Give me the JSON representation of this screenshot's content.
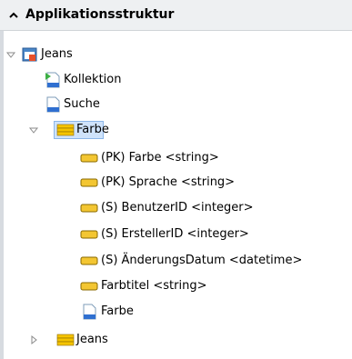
{
  "header": {
    "title": "Applikationsstruktur",
    "icon": "chevron-up-icon"
  },
  "tree": {
    "root": {
      "label": "Jeans",
      "icon": "application-icon",
      "expanded": true
    },
    "kollektion": {
      "label": "Kollektion",
      "icon": "page-arrow-icon"
    },
    "suche": {
      "label": "Suche",
      "icon": "page-icon"
    },
    "farbe_table": {
      "label": "Farbe",
      "icon": "table-icon",
      "expanded": true,
      "selected": true
    },
    "fields": [
      {
        "label": "(PK) Farbe <string>",
        "icon": "field-icon"
      },
      {
        "label": "(PK) Sprache <string>",
        "icon": "field-icon"
      },
      {
        "label": "(S) BenutzerID <integer>",
        "icon": "field-icon"
      },
      {
        "label": "(S) ErstellerID <integer>",
        "icon": "field-icon"
      },
      {
        "label": "(S) ÄnderungsDatum <datetime>",
        "icon": "field-icon"
      },
      {
        "label": "Farbtitel <string>",
        "icon": "field-icon"
      }
    ],
    "farbe_page": {
      "label": "Farbe",
      "icon": "page-icon"
    },
    "jeans_table": {
      "label": "Jeans",
      "icon": "table-icon",
      "expanded": false
    }
  },
  "colors": {
    "selection": "#cfe3fb",
    "selection_border": "#8cb6e8",
    "field_yellow": "#f3c632",
    "table_yellow": "#f5c400"
  }
}
